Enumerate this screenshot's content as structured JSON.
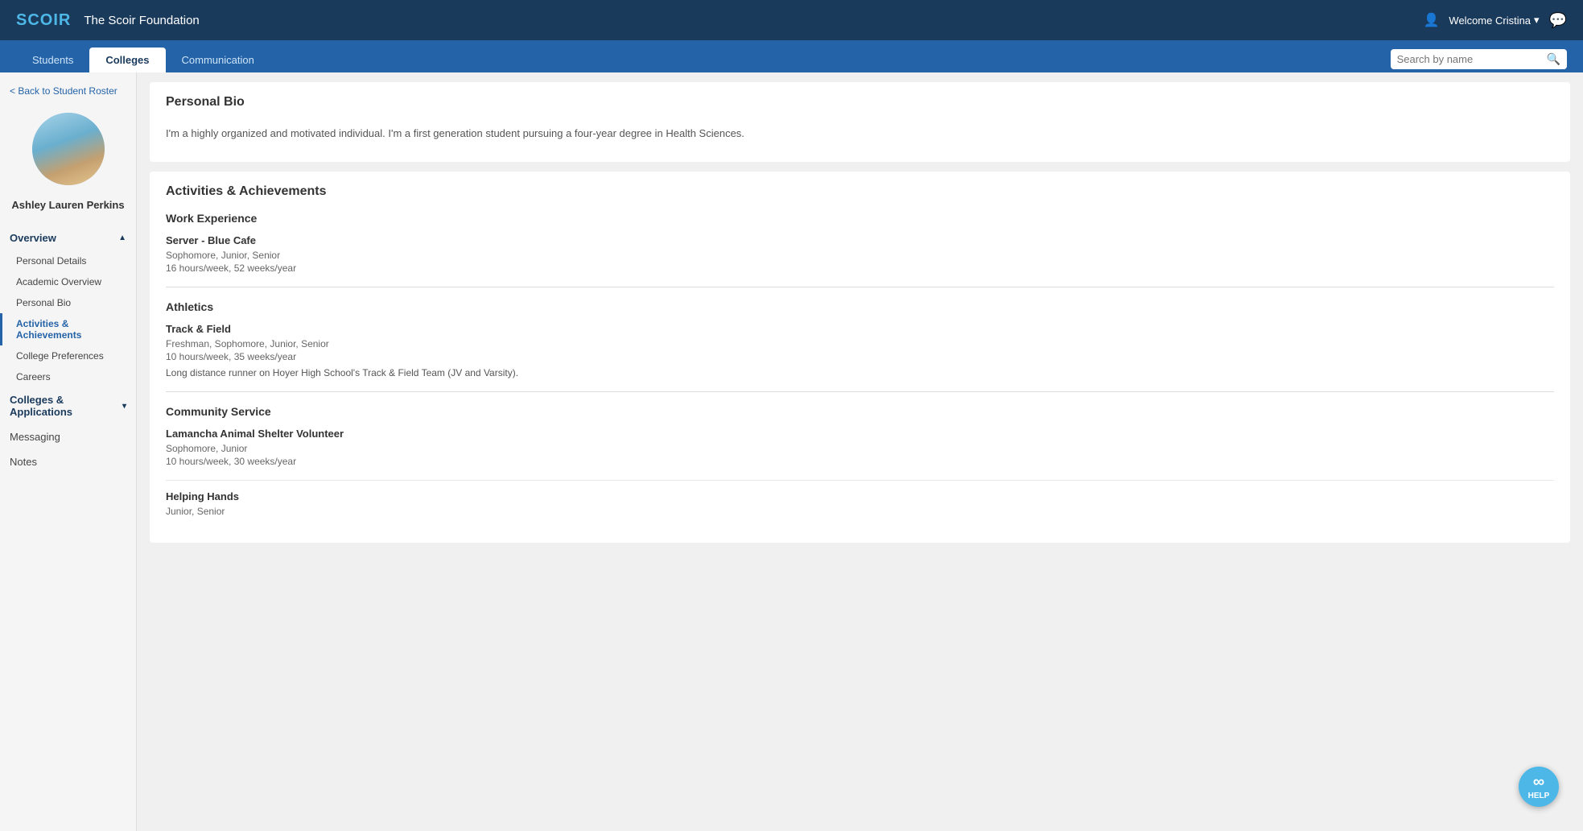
{
  "topbar": {
    "logo": "SCOIR",
    "title": "The Scoir Foundation",
    "welcome": "Welcome Cristina",
    "welcome_chevron": "▾"
  },
  "navbar": {
    "tabs": [
      {
        "label": "Students",
        "active": false
      },
      {
        "label": "Colleges",
        "active": true
      },
      {
        "label": "Communication",
        "active": false
      }
    ],
    "search_placeholder": "Search by name"
  },
  "sidebar": {
    "back_label": "< Back to Student Roster",
    "student_name": "Ashley Lauren Perkins",
    "overview_label": "Overview",
    "items": [
      {
        "label": "Personal Details",
        "active": false
      },
      {
        "label": "Academic Overview",
        "active": false
      },
      {
        "label": "Personal Bio",
        "active": false
      },
      {
        "label": "Activities & Achievements",
        "active": true
      },
      {
        "label": "College Preferences",
        "active": false
      },
      {
        "label": "Careers",
        "active": false
      }
    ],
    "colleges_label": "Colleges & Applications",
    "colleges_chevron": "▾",
    "messaging_label": "Messaging",
    "notes_label": "Notes"
  },
  "personal_bio": {
    "title": "Personal Bio",
    "text": "I'm a highly organized and motivated individual. I'm a first generation student pursuing a four-year degree in Health Sciences."
  },
  "activities": {
    "title": "Activities & Achievements",
    "sections": [
      {
        "title": "Work Experience",
        "items": [
          {
            "name": "Server - Blue Cafe",
            "years": "Sophomore, Junior, Senior",
            "hours": "16 hours/week, 52 weeks/year",
            "note": null
          }
        ]
      },
      {
        "title": "Athletics",
        "items": [
          {
            "name": "Track & Field",
            "years": "Freshman, Sophomore, Junior, Senior",
            "hours": "10 hours/week, 35 weeks/year",
            "note": "Long distance runner on Hoyer High School's Track & Field Team (JV and Varsity)."
          }
        ]
      },
      {
        "title": "Community Service",
        "items": [
          {
            "name": "Lamancha Animal Shelter Volunteer",
            "years": "Sophomore, Junior",
            "hours": "10 hours/week, 30 weeks/year",
            "note": null
          },
          {
            "name": "Helping Hands",
            "years": "Junior, Senior",
            "hours": "",
            "note": null
          }
        ]
      }
    ]
  },
  "help": {
    "label": "HELP"
  }
}
